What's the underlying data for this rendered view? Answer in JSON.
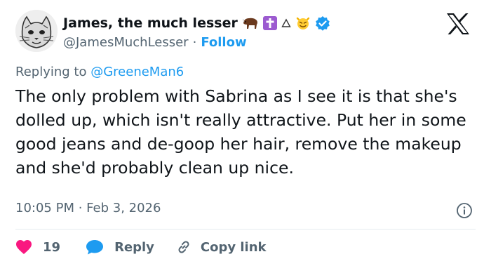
{
  "author": {
    "display_name": "James, the much lesser",
    "handle": "@JamesMuchLesser",
    "separator": "·",
    "follow_label": "Follow",
    "name_emojis": [
      "bison-icon",
      "cross-icon",
      "triangle-icon",
      "devil-face-icon",
      "verified-badge-icon"
    ]
  },
  "reply_context": {
    "prefix": "Replying to",
    "mention": "@GreeneMan6"
  },
  "tweet": {
    "text": "The only problem with Sabrina as I see it is that she's dolled up, which isn't really attractive. Put her in some good jeans and de-goop her hair, remove the makeup and she'd probably clean up nice.",
    "timestamp": "10:05 PM · Feb 3, 2026"
  },
  "actions": {
    "like_count": "19",
    "reply_label": "Reply",
    "copy_link_label": "Copy link"
  },
  "colors": {
    "accent": "#1d9bf0",
    "like": "#f91880",
    "secondary_text": "#536471",
    "primary_text": "#0f1419"
  }
}
